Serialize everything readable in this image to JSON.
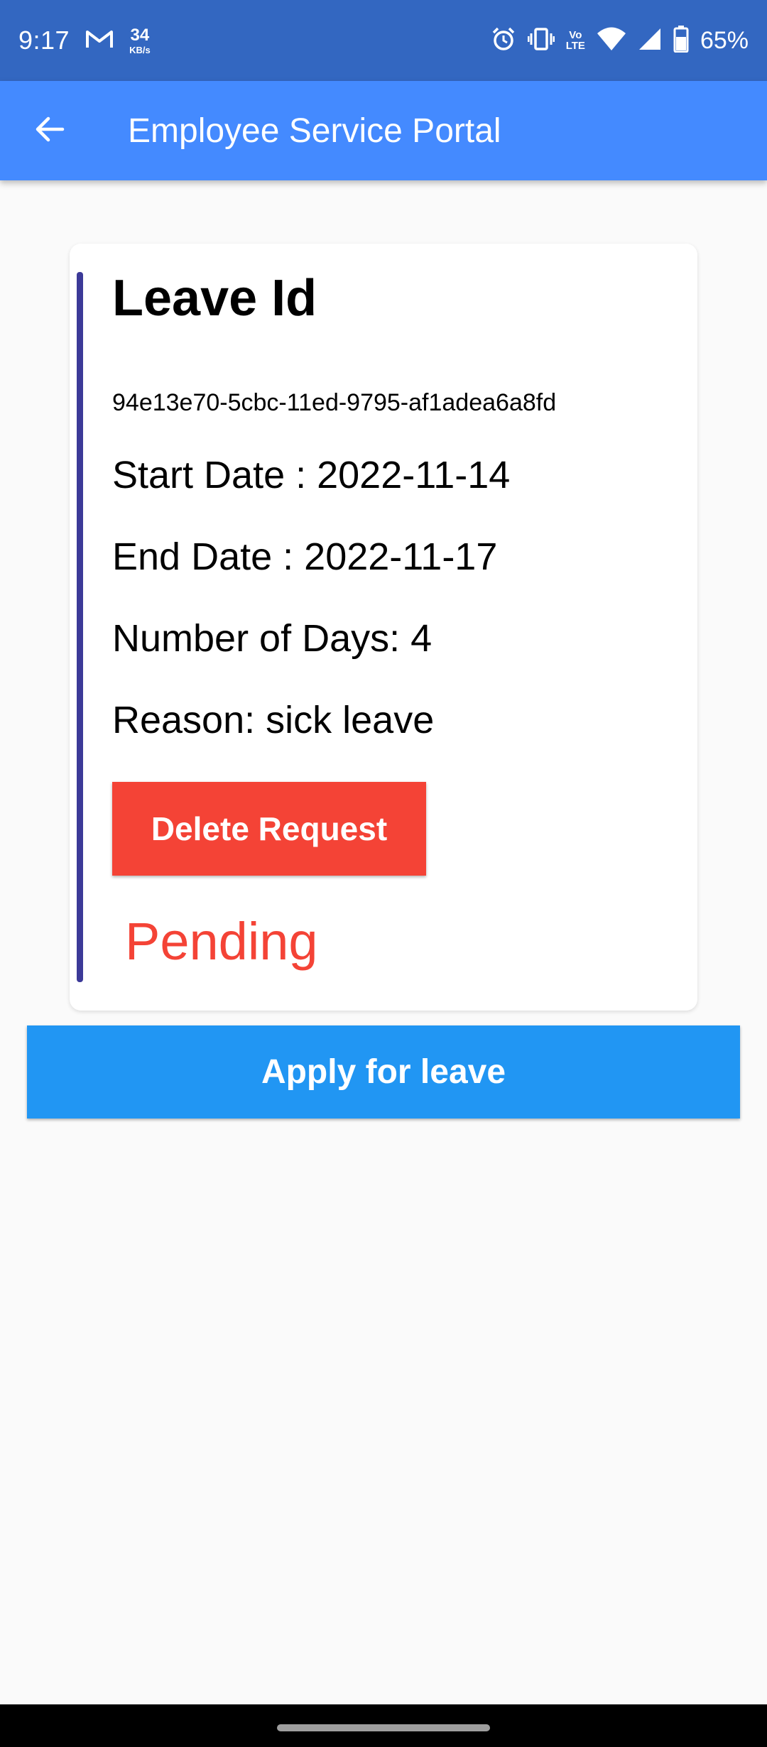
{
  "status_bar": {
    "time": "9:17",
    "data_rate_value": "34",
    "data_rate_unit": "KB/s",
    "volte_top": "Vo",
    "volte_bottom": "LTE",
    "battery_percent": "65%",
    "icons": [
      "gmail-icon",
      "alarm-icon",
      "vibrate-icon",
      "volte-icon",
      "wifi-icon",
      "signal-icon",
      "battery-icon"
    ]
  },
  "app_bar": {
    "title": "Employee Service Portal",
    "back_icon": "arrow-left-icon"
  },
  "leave_card": {
    "title": "Leave Id",
    "leave_id": "94e13e70-5cbc-11ed-9795-af1adea6a8fd",
    "start_date": "Start Date : 2022-11-14",
    "end_date": "End Date : 2022-11-17",
    "number_of_days": "Number of Days: 4",
    "reason": "Reason: sick leave",
    "delete_label": "Delete Request",
    "status": "Pending"
  },
  "apply_label": "Apply for leave",
  "colors": {
    "status_bar": "#3367c1",
    "app_bar": "#448aff",
    "card_accent": "#3c3a98",
    "delete_button": "#f44336",
    "status_pending": "#f44336",
    "apply_button": "#2196f3",
    "background": "#fafafa"
  }
}
